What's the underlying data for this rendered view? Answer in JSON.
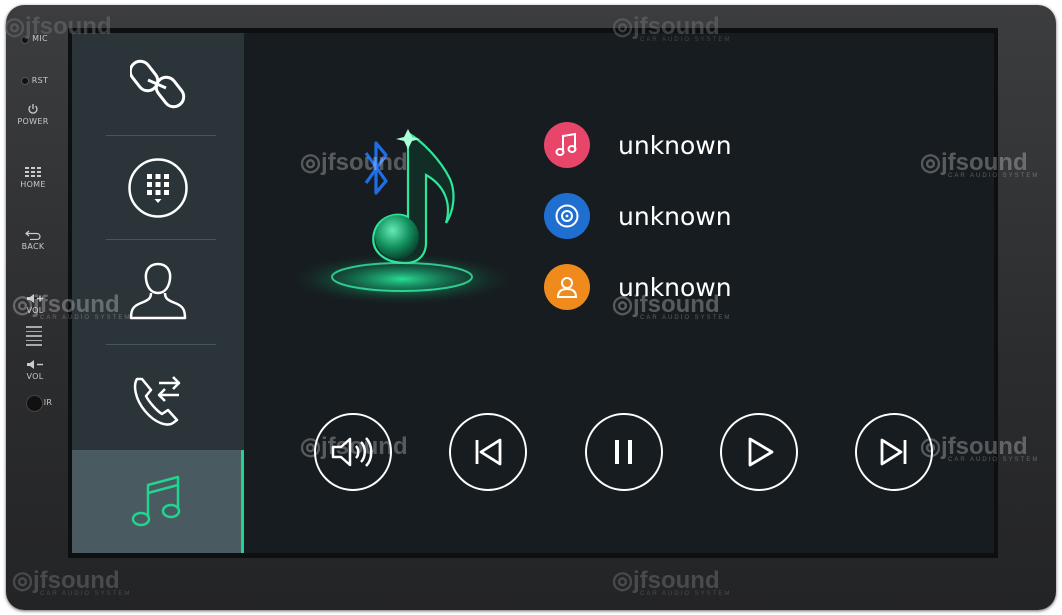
{
  "hardware": {
    "mic_label": "MIC",
    "rst_label": "RST",
    "power_label": "POWER",
    "home_label": "HOME",
    "back_label": "BACK",
    "vol_up_label": "VOL",
    "vol_down_label": "VOL",
    "ir_label": "IR"
  },
  "sidebar": {
    "items": [
      {
        "icon": "link-icon"
      },
      {
        "icon": "dialpad-icon"
      },
      {
        "icon": "contact-icon"
      },
      {
        "icon": "call-transfer-icon"
      },
      {
        "icon": "music-icon",
        "active": true
      }
    ]
  },
  "track": {
    "title": "unknown",
    "album": "unknown",
    "artist": "unknown"
  },
  "watermark": {
    "brand": "jfsound",
    "sub": "CAR AUDIO SYSTEM"
  },
  "colors": {
    "accent": "#20d58e",
    "title_icon_bg": "#e8456b",
    "album_icon_bg": "#1f6fd1",
    "artist_icon_bg": "#f08a1c",
    "bluetooth": "#1e6ee8"
  }
}
